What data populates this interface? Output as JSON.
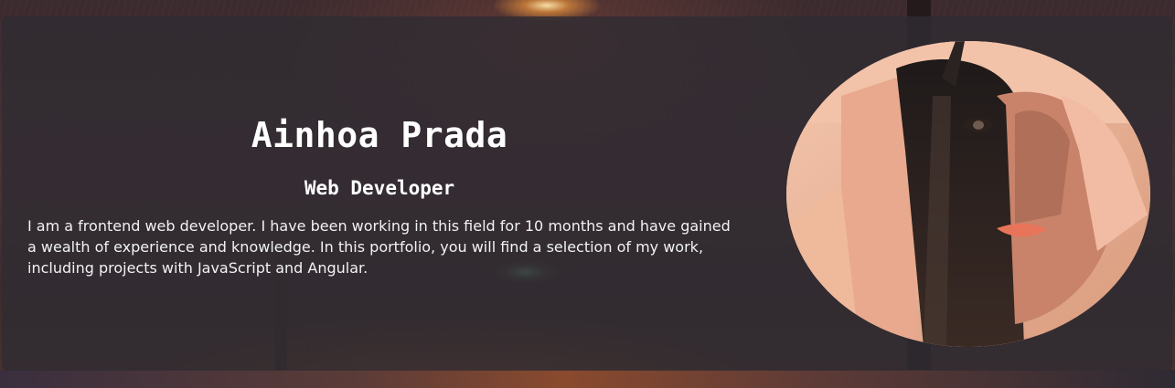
{
  "profile": {
    "name": "Ainhoa Prada",
    "role": "Web Developer",
    "bio": "I am a frontend web developer. I have been working in this field for 10 months and have gained a wealth of experience and knowledge. In this portfolio, you will find a selection of my work, including projects with JavaScript and Angular."
  },
  "colors": {
    "card_bg": "#302c32",
    "text": "#ffffff",
    "accent_warm": "#e9b8a0"
  },
  "icons": {
    "portrait": "profile-photo"
  }
}
